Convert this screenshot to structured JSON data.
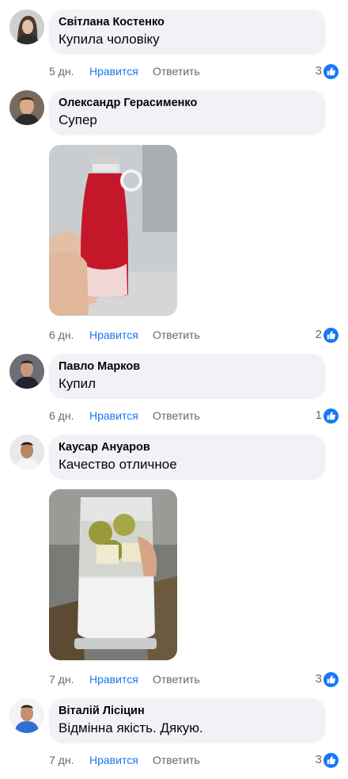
{
  "like_label": "Нравится",
  "reply_label": "Ответить",
  "colors": {
    "like_blue": "#1877f2",
    "bubble_bg": "#f0f2f5",
    "meta_gray": "#65676b"
  },
  "comments": [
    {
      "author": "Світлана Костенко",
      "text": "Купила чоловіку",
      "time": "5 дн.",
      "reactions": "3",
      "avatar_icon": "user-avatar-icon"
    },
    {
      "author": "Олександр Герасименко",
      "text": "Супер",
      "time": "6 дн.",
      "reactions": "2",
      "avatar_icon": "user-avatar-icon",
      "photo": "red-bottle-blender-photo"
    },
    {
      "author": "Павло Марков",
      "text": "Купил",
      "time": "6 дн.",
      "reactions": "1",
      "avatar_icon": "user-avatar-icon"
    },
    {
      "author": "Каусар Ануаров",
      "text": "Качество отличное",
      "time": "7 дн.",
      "reactions": "3",
      "avatar_icon": "user-avatar-icon",
      "photo": "fruit-in-blender-photo"
    },
    {
      "author": "Віталій Лісіцин",
      "text": "Відмінна якість. Дякую.",
      "time": "7 дн.",
      "reactions": "3",
      "avatar_icon": "user-avatar-icon"
    }
  ]
}
